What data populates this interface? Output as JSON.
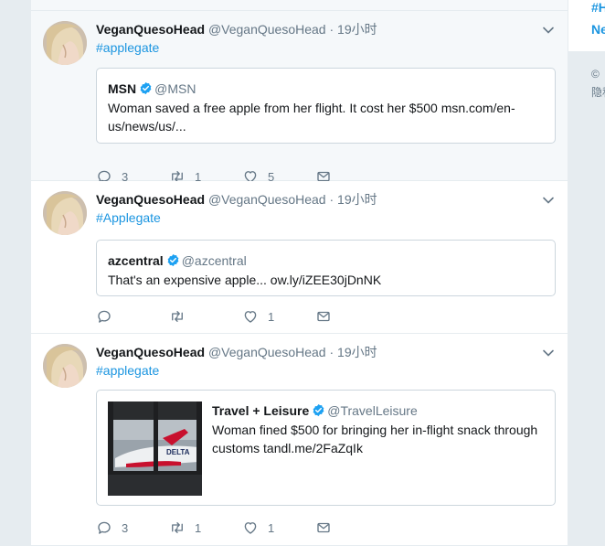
{
  "tweets": [
    {
      "author": {
        "name": "VeganQuesoHead",
        "handle": "@VeganQuesoHead",
        "time": "19小时"
      },
      "hashtag": "#applegate",
      "quote": {
        "name": "MSN",
        "handle": "@MSN",
        "text": "Woman saved a free apple from her flight. It cost her $500 msn.com/en-us/news/us/..."
      },
      "actions": {
        "replies": "3",
        "retweets": "1",
        "likes": "5"
      }
    },
    {
      "author": {
        "name": "VeganQuesoHead",
        "handle": "@VeganQuesoHead",
        "time": "19小时"
      },
      "hashtag": "#Applegate",
      "quote": {
        "name": "azcentral",
        "handle": "@azcentral",
        "text": "That's an expensive apple... ow.ly/iZEE30jDnNK"
      },
      "actions": {
        "replies": "",
        "retweets": "",
        "likes": "1"
      }
    },
    {
      "author": {
        "name": "VeganQuesoHead",
        "handle": "@VeganQuesoHead",
        "time": "19小时"
      },
      "hashtag": "#applegate",
      "quote": {
        "name": "Travel + Leisure",
        "handle": "@TravelLeisure",
        "text": "Woman fined $500 for bringing her in-flight snack through customs tandl.me/2FaZqIk",
        "image_label": "DELTA"
      },
      "actions": {
        "replies": "3",
        "retweets": "1",
        "likes": "1"
      }
    }
  ],
  "separator": "·",
  "sidebar": {
    "line1": "#H",
    "line2": "Ne",
    "line3": "©",
    "line4": "隐私"
  },
  "icons": {
    "reply": "reply-icon",
    "retweet": "retweet-icon",
    "like": "heart-icon",
    "dm": "envelope-icon",
    "verified": "verified-badge-icon",
    "caret": "chevron-down-icon"
  },
  "colors": {
    "link": "#1b95e0",
    "muted": "#657786",
    "text": "#14171a",
    "border": "#e6ecf0",
    "verified": "#1da1f2"
  }
}
